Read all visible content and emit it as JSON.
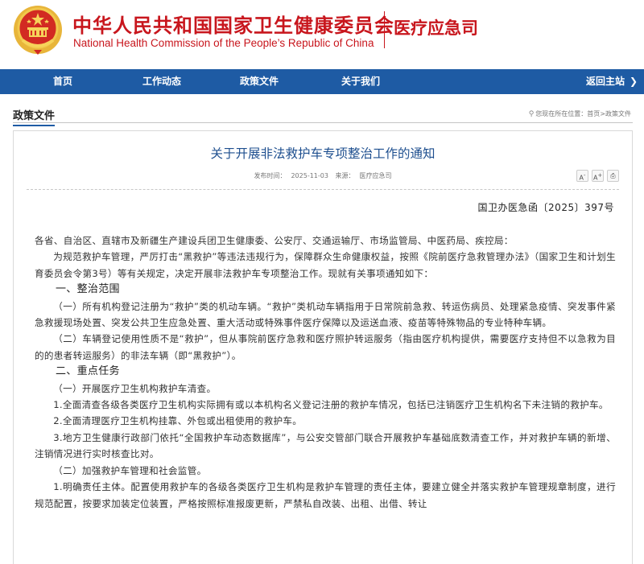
{
  "header": {
    "title_cn": "中华人民共和国国家卫生健康委员会",
    "title_en": "National Health Commission of the People’s Republic of China",
    "department": "医疗应急司",
    "emblem_icon": "national-emblem-icon"
  },
  "nav": {
    "home": "首页",
    "work": "工作动态",
    "policy": "政策文件",
    "about": "关于我们",
    "back": "返回主站",
    "back_icon": "chevron-circle-right-icon"
  },
  "section": {
    "title": "政策文件",
    "location": "您现在所在位置：首页>政策文件",
    "location_icon": "location-pin-icon"
  },
  "article": {
    "title": "关于开展非法救护车专项整治工作的通知",
    "publish_label": "发布时间：",
    "publish_date": "2025-11-03",
    "source_label": "来源：",
    "source": "医疗应急司",
    "tools": {
      "font_smaller": "A",
      "font_larger": "A",
      "print_icon": "print-icon"
    },
    "doc_number": "国卫办医急函〔2025〕397号",
    "paragraphs": {
      "p1": "各省、自治区、直辖市及新疆生产建设兵团卫生健康委、公安厅、交通运输厅、市场监管局、中医药局、疾控局：",
      "p2": "为规范救护车管理，严厉打击“黑救护”等违法违规行为，保障群众生命健康权益，按照《院前医疗急救管理办法》（国家卫生和计划生育委员会令第3号）等有关规定，决定开展非法救护车专项整治工作。现就有关事项通知如下：",
      "h1": "一、整治范围",
      "p3": "（一）所有机构登记注册为“救护”类的机动车辆。“救护”类机动车辆指用于日常院前急救、转运伤病员、处理紧急疫情、突发事件紧急救援现场处置、突发公共卫生应急处置、重大活动或特殊事件医疗保障以及运送血液、疫苗等特殊物品的专业特种车辆。",
      "p4": "（二）车辆登记使用性质不是“救护”，但从事院前医疗急救和医疗照护转运服务（指由医疗机构提供，需要医疗支持但不以急救为目的的患者转运服务）的非法车辆（即“黑救护”）。",
      "h2": "二、重点任务",
      "p5": "（一）开展医疗卫生机构救护车清查。",
      "p6": "1.全面清查各级各类医疗卫生机构实际拥有或以本机构名义登记注册的救护车情况，包括已注销医疗卫生机构名下未注销的救护车。",
      "p7": "2.全面清理医疗卫生机构挂靠、外包或出租使用的救护车。",
      "p8": "3.地方卫生健康行政部门依托“全国救护车动态数据库”，与公安交管部门联合开展救护车基础底数清查工作，并对救护车辆的新增、注销情况进行实时核查比对。",
      "p9": "（二）加强救护车管理和社会监管。",
      "p10": "1.明确责任主体。配置使用救护车的各级各类医疗卫生机构是救护车管理的责任主体，要建立健全并落实救护车管理规章制度，进行规范配置，按要求加装定位装置，严格按照标准报废更新，严禁私自改装、出租、出借、转让"
    }
  }
}
